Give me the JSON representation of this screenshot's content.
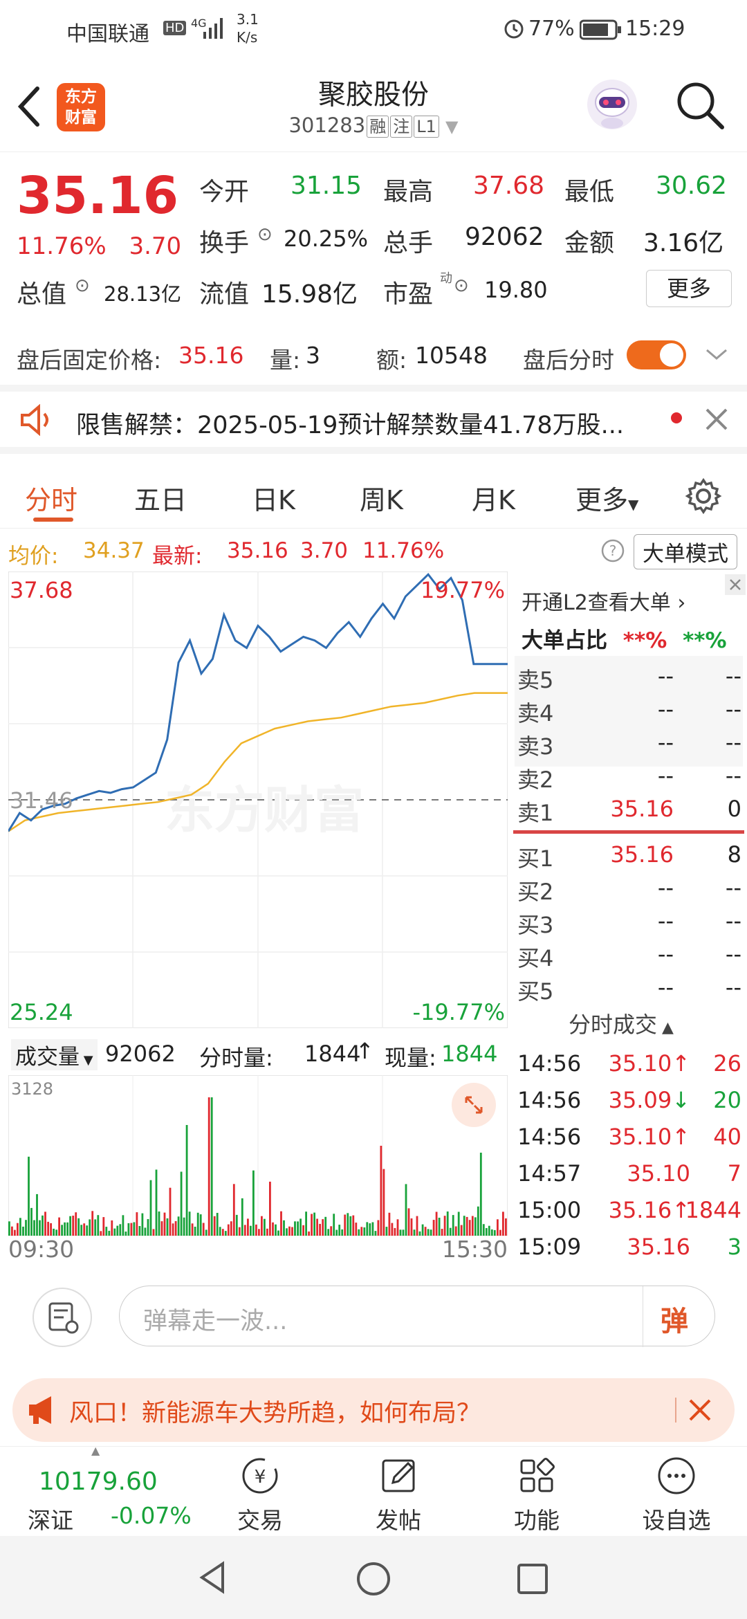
{
  "status_bar": {
    "carrier": "中国联通",
    "hd": "HD",
    "signal": "4G",
    "speed_value": "3.1",
    "speed_unit": "K/s",
    "battery": "77%",
    "time": "15:29"
  },
  "header": {
    "logo_line1": "东方",
    "logo_line2": "财富",
    "stock_name": "聚胶股份",
    "stock_code": "301283",
    "tag_margin": "融",
    "tag_registration": "注",
    "tag_level": "L1"
  },
  "quote": {
    "price": "35.16",
    "change_pct": "11.76%",
    "change": "3.70",
    "open_label": "今开",
    "open": "31.15",
    "high_label": "最高",
    "high": "37.68",
    "low_label": "最低",
    "low": "30.62",
    "turnover_label": "换手",
    "turnover": "20.25%",
    "volume_label": "总手",
    "volume": "92062",
    "amount_label": "金额",
    "amount": "3.16亿",
    "mktcap_label": "总值",
    "mktcap": "28.13亿",
    "float_label": "流值",
    "float_cap": "15.98亿",
    "pe_label": "市盈",
    "pe_sup": "动",
    "pe": "19.80",
    "more_label": "更多"
  },
  "after_hours": {
    "price_label": "盘后固定价格:",
    "price": "35.16",
    "vol_label": "量:",
    "vol": "3",
    "amt_label": "额:",
    "amt": "10548",
    "toggle_label": "盘后分时"
  },
  "notice": {
    "text": "限售解禁：2025-05-19预计解禁数量41.78万股..."
  },
  "tabs": [
    "分时",
    "五日",
    "日K",
    "周K",
    "月K",
    "更多"
  ],
  "avg_bar": {
    "avg_label": "均价:",
    "avg": "34.37",
    "latest_label": "最新:",
    "latest": "35.16",
    "latest_chg": "3.70",
    "latest_pct": "11.76%",
    "mode_label": "大单模式"
  },
  "chart_data": {
    "type": "line",
    "y_top_label": "37.68",
    "y_mid_label": "31.46",
    "y_bottom_label": "25.24",
    "pct_top_label": "19.77%",
    "pct_bottom_label": "-19.77%",
    "watermark": "东方财富",
    "ylim": [
      25.24,
      37.68
    ],
    "prev_close": 31.46,
    "x_start_label": "09:30",
    "x_end_label": "15:30",
    "series": [
      {
        "values": [
          30.6,
          31.1,
          30.9,
          31.2,
          31.3,
          31.35,
          31.5,
          31.6,
          31.7,
          31.65,
          31.75,
          31.8,
          32.0,
          32.2,
          33.1,
          35.2,
          35.8,
          34.9,
          35.3,
          36.5,
          35.8,
          35.6,
          36.2,
          35.9,
          35.5,
          35.7,
          35.9,
          35.8,
          35.6,
          36.0,
          36.3,
          35.9,
          36.4,
          36.8,
          36.4,
          37.0,
          37.3,
          37.6,
          37.2,
          37.5,
          36.9,
          35.16,
          35.16,
          35.16,
          35.16
        ]
      },
      {
        "values": [
          30.6,
          30.9,
          31.0,
          31.1,
          31.15,
          31.2,
          31.25,
          31.3,
          31.35,
          31.4,
          31.5,
          31.6,
          31.9,
          32.5,
          33.0,
          33.2,
          33.4,
          33.5,
          33.6,
          33.65,
          33.7,
          33.8,
          33.9,
          34.0,
          34.05,
          34.1,
          34.2,
          34.3,
          34.37,
          34.37,
          34.37
        ]
      }
    ]
  },
  "order_book": {
    "l2_label": "开通L2查看大单",
    "ratio_label": "大单占比",
    "ratio_red": "**%",
    "ratio_green": "**%",
    "sells": [
      {
        "name": "卖5",
        "price": "--",
        "vol": "--"
      },
      {
        "name": "卖4",
        "price": "--",
        "vol": "--"
      },
      {
        "name": "卖3",
        "price": "--",
        "vol": "--"
      },
      {
        "name": "卖2",
        "price": "--",
        "vol": "--"
      },
      {
        "name": "卖1",
        "price": "35.16",
        "vol": "0"
      }
    ],
    "buys": [
      {
        "name": "买1",
        "price": "35.16",
        "vol": "8"
      },
      {
        "name": "买2",
        "price": "--",
        "vol": "--"
      },
      {
        "name": "买3",
        "price": "--",
        "vol": "--"
      },
      {
        "name": "买4",
        "price": "--",
        "vol": "--"
      },
      {
        "name": "买5",
        "price": "--",
        "vol": "--"
      }
    ],
    "ticks_label": "分时成交",
    "ticks": [
      {
        "time": "14:56",
        "price": "35.10",
        "dir": "↑",
        "vol": "26",
        "color": "#e0282e"
      },
      {
        "time": "14:56",
        "price": "35.09",
        "dir": "↓",
        "vol": "20",
        "color": "#18a23a"
      },
      {
        "time": "14:56",
        "price": "35.10",
        "dir": "↑",
        "vol": "40",
        "color": "#e0282e"
      },
      {
        "time": "14:57",
        "price": "35.10",
        "dir": "",
        "vol": "7",
        "color": "#e0282e"
      },
      {
        "time": "15:00",
        "price": "35.16",
        "dir": "↑",
        "vol": "1844",
        "color": "#e0282e"
      },
      {
        "time": "15:09",
        "price": "35.16",
        "dir": "",
        "vol": "3",
        "color": "#18a23a"
      }
    ]
  },
  "volume_bar": {
    "label": "成交量",
    "total": "92062",
    "minute_label": "分时量:",
    "minute": "1844",
    "current_label": "现量:",
    "current": "1844",
    "max_label": "3128"
  },
  "danmu": {
    "placeholder": "弹幕走一波...",
    "send_label": "弹"
  },
  "ad": {
    "text": "风口！新能源车大势所趋，如何布局？"
  },
  "bottom_nav": {
    "index_value": "10179.60",
    "index_name": "深证",
    "index_change": "-0.07%",
    "items": [
      {
        "label": "交易"
      },
      {
        "label": "发帖"
      },
      {
        "label": "功能"
      },
      {
        "label": "设自选"
      }
    ]
  },
  "colors": {
    "up": "#e0282e",
    "down": "#18a23a",
    "accent": "#e0582a",
    "price_line": "#2f6db3",
    "avg_line": "#f0b429"
  }
}
